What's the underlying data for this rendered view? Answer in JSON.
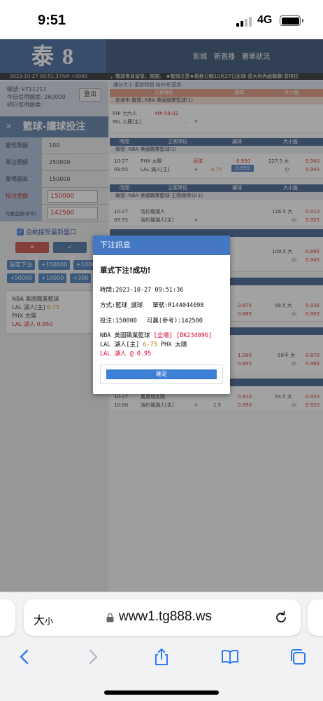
{
  "status": {
    "time": "9:51",
    "network": "4G"
  },
  "site": {
    "logo": "泰 8",
    "nav": [
      "影城",
      "新直播",
      "審單狀況"
    ],
    "ticker_datetime": "2023-10-27 09:51:37AM +0000",
    "ticker_text": "，敬請會員留意，謝謝。  ★敬請注意★帳務日期10月27日足球-意大利丙組聯賽(意特拉"
  },
  "account": {
    "line1": "帳號: k711211",
    "line2": "今日信用額度: 260000",
    "line3": "明日信用額度:",
    "logout": "登出"
  },
  "betform": {
    "title": "籃球-讓球投注",
    "min_label": "最低限額",
    "min_value": "100",
    "single_label": "單注限額",
    "single_value": "250000",
    "max_label": "單場最高",
    "max_value": "150000",
    "amount_label": "投注金額",
    "amount_value": "150000",
    "win_label": "可贏金額(參考)",
    "win_value": "142500",
    "auto_accept": "自動接受最新盤口",
    "cancel": "取消",
    "confirm": "確定",
    "quick": [
      "設定下注",
      "+150000",
      "+1000",
      "+50000",
      "+10000",
      "+300"
    ],
    "slip_league": "NBA 美國職業籃球",
    "slip_teams_a": "LAL 湖人[主]",
    "slip_hcp": "6-75",
    "slip_teams_b": "PHX 太陽",
    "slip_pick": "LAL 湖人 0.950"
  },
  "right": {
    "bar1": "讓分大小      更新時間        每60秒更新",
    "live_header": [
      "主客隊伍",
      "讓球",
      "大小盤"
    ],
    "live_league": "走地中:聯盟: NBA 美國職業籃球(1)",
    "live_match": {
      "home": "PHI 七六人",
      "away": "MIL 公鹿[主]",
      "quarter": "4th 08:02"
    },
    "hdr": [
      "時間",
      "主客隊伍",
      "讓球",
      "大小盤"
    ],
    "league1": "聯盟: NBA 美國職業籃球(1)",
    "m1": {
      "date": "10-27",
      "time": "09:55",
      "t1": "PHX 太陽",
      "t2": "LAL 湖人[主]",
      "tag": "滾球",
      "hcp": "6-75",
      "o1": "0.950",
      "o2": "0.950",
      "ou": "227.5 大",
      "ou2": "小",
      "p1": "0.940",
      "p2": "0.940"
    },
    "league2": "聯盟: NBA 美國職業籃球-主隊總得分(1)",
    "m2": {
      "date": "10-27",
      "time": "09:55",
      "t1": "洛杉磯湖人",
      "t2": "洛杉磯湖人[主]",
      "ou": "116.5 大",
      "ou2": "小",
      "p1": "0.910",
      "p2": "0.925"
    },
    "m3": {
      "ou": "109.5 大",
      "ou2": "小",
      "p1": "0.895",
      "p2": "0.945"
    },
    "m4": {
      "o1": "0.975",
      "o2": "0.885",
      "ou": "58.5 大",
      "ou2": "小",
      "p1": "0.935",
      "p2": "0.905"
    },
    "m5": {
      "o1": "1.000",
      "o2": "0.855",
      "ou": "58平 大",
      "ou2": "小",
      "p1": "0.870",
      "p2": "0.965"
    },
    "m6": {
      "date": "10-27",
      "time": "10:00",
      "t1": "鳳凰城太陽",
      "t2": "洛杉磯湖人[主]",
      "hcp": "1.5",
      "o1": "0.910",
      "o2": "0.950",
      "ou": "54.5 大",
      "ou2": "小",
      "p1": "0.920",
      "p2": "0.920"
    }
  },
  "modal": {
    "header": "下注訊息",
    "title": "單式下注!成功!",
    "time": "時間:2023-10-27 09:51:36",
    "mode": "方式:籃球_讓球",
    "ticket": "單號:R144044698",
    "stake": "投注:150000",
    "win": "可贏(參考):142500",
    "league": "NBA 美國職業籃球",
    "period": "[全場]",
    "code": "[BK234096]",
    "teams_a": "LAL 湖人[主]",
    "hcp": "6-75",
    "teams_b": "PHX 太陽",
    "pick": "LAL 湖人 @ 0.95",
    "confirm": "確定"
  },
  "browser": {
    "text_size": "大",
    "text_size_small": "小",
    "url": "www1.tg888.ws"
  }
}
